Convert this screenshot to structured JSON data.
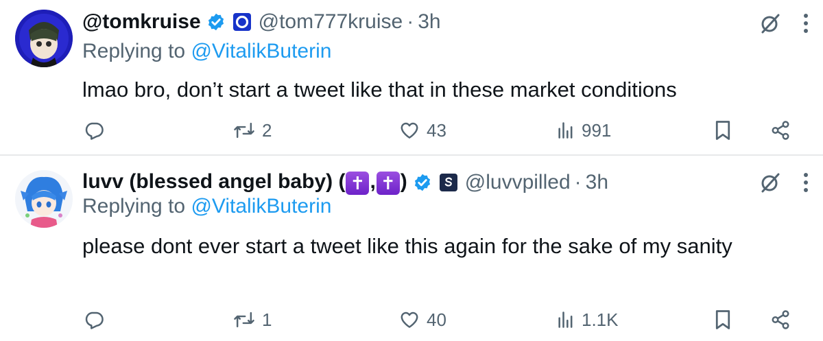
{
  "colors": {
    "text": "#0f1419",
    "secondary": "#536471",
    "link": "#1d9bf0",
    "verified": "#1d9bf0",
    "divider": "#e7e9ea"
  },
  "tweets": [
    {
      "display_name": "@tomkruise",
      "handle": "@tom777kruise",
      "separator": "·",
      "time": "3h",
      "replying_prefix": "Replying to",
      "replying_to": "@VitalikButerin",
      "text": "lmao bro, don’t start a tweet like that in these market conditions",
      "counts": {
        "replies": "",
        "retweets": "2",
        "likes": "43",
        "views": "991"
      }
    },
    {
      "display_name_prefix": "luvv (blessed angel baby) (",
      "cross_1": "✝",
      "comma": ",",
      "cross_2": "✝",
      "display_name_suffix": ")",
      "handle": "@luvvpilled",
      "separator": "·",
      "time": "3h",
      "replying_prefix": "Replying to",
      "replying_to": "@VitalikButerin",
      "text": "please dont ever start a tweet like this again for the sake of my sanity",
      "counts": {
        "replies": "",
        "retweets": "1",
        "likes": "40",
        "views": "1.1K"
      }
    }
  ],
  "icons": [
    "reply-icon",
    "retweet-icon",
    "like-icon",
    "views-icon",
    "bookmark-icon",
    "share-icon",
    "grok-icon",
    "more-icon",
    "verified-icon",
    "affiliate-badge-icon"
  ]
}
